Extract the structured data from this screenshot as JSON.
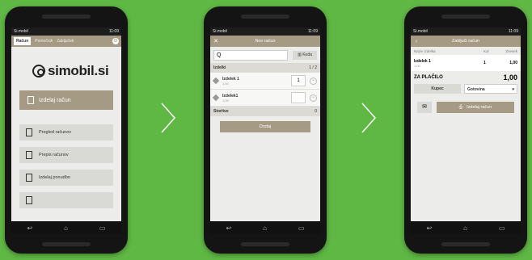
{
  "status": {
    "carrier": "Si.mobil",
    "time": "11:09"
  },
  "screen1": {
    "tabs": [
      "Račun",
      "Pomočnik",
      "Zaključek"
    ],
    "logo": "simobil.si",
    "primary_button": "Izdelaj račun",
    "menu": [
      "Pregled računov",
      "Prepis računov",
      "Izdelaj ponudbo"
    ]
  },
  "screen2": {
    "title": "Nov račun",
    "search_icon": "Q",
    "koda_button": "Koda",
    "section_label": "Izdelki",
    "section_count": "1 / 2",
    "items": [
      {
        "name": "Izdelek 1",
        "sub": "1,00",
        "qty": "1"
      },
      {
        "name": "Izdelek1",
        "sub": "1,00",
        "qty": ""
      }
    ],
    "storitve_label": "Storitve",
    "storitve_count": "0",
    "add_button": "Dodaj"
  },
  "screen3": {
    "title": "Zaključi račun",
    "columns": [
      "Naziv izdelka",
      "Kol",
      "Znesek"
    ],
    "row": {
      "name": "Izdelek 1",
      "sub": "1,00",
      "qty": "1",
      "price": "1,00"
    },
    "total_label": "ZA PLAČILO",
    "total_value": "1,00",
    "customer_button": "Kupec",
    "payment_select": "Gotovina",
    "issue_button": "Izdelaj račun"
  },
  "nav_icons": [
    "back-icon",
    "home-icon",
    "recent-icon"
  ],
  "colors": {
    "accent": "#a59a83",
    "background": "#5fb744"
  }
}
